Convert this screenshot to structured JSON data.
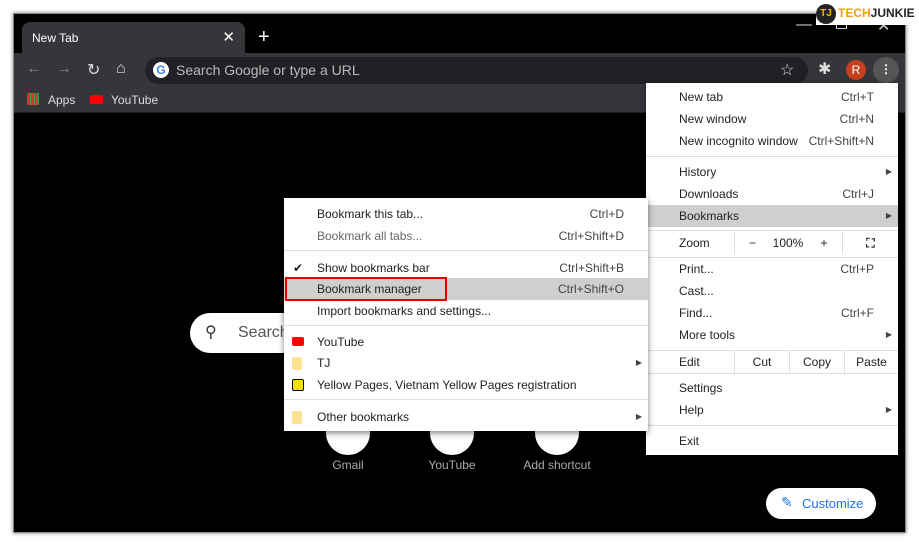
{
  "tab": {
    "title": "New Tab",
    "close": "✕",
    "new": "+"
  },
  "toolbar": {
    "omnibox_placeholder": "Search Google or type a URL",
    "avatar": "R"
  },
  "bookmarks_bar": [
    {
      "label": "Apps",
      "icon": "apps-grid-icon"
    },
    {
      "label": "YouTube",
      "icon": "youtube-icon"
    }
  ],
  "watermark": {
    "text_a": "TECH",
    "text_b": "JUNKIE",
    "mark": "TJ"
  },
  "chrome_menu": {
    "new_tab": {
      "label": "New tab",
      "shortcut": "Ctrl+T"
    },
    "new_window": {
      "label": "New window",
      "shortcut": "Ctrl+N"
    },
    "incognito": {
      "label": "New incognito window",
      "shortcut": "Ctrl+Shift+N"
    },
    "history": {
      "label": "History"
    },
    "downloads": {
      "label": "Downloads",
      "shortcut": "Ctrl+J"
    },
    "bookmarks": {
      "label": "Bookmarks"
    },
    "zoom": {
      "label": "Zoom",
      "minus": "−",
      "value": "100%",
      "plus": "+"
    },
    "print": {
      "label": "Print...",
      "shortcut": "Ctrl+P"
    },
    "cast": {
      "label": "Cast..."
    },
    "find": {
      "label": "Find...",
      "shortcut": "Ctrl+F"
    },
    "more_tools": {
      "label": "More tools"
    },
    "edit": {
      "label": "Edit",
      "cut": "Cut",
      "copy": "Copy",
      "paste": "Paste"
    },
    "settings": {
      "label": "Settings"
    },
    "help": {
      "label": "Help"
    },
    "exit": {
      "label": "Exit"
    }
  },
  "bookmarks_menu": {
    "bookmark_tab": {
      "label": "Bookmark this tab...",
      "shortcut": "Ctrl+D"
    },
    "bookmark_all": {
      "label": "Bookmark all tabs...",
      "shortcut": "Ctrl+Shift+D"
    },
    "show_bar": {
      "label": "Show bookmarks bar",
      "shortcut": "Ctrl+Shift+B",
      "checked": true
    },
    "manager": {
      "label": "Bookmark manager",
      "shortcut": "Ctrl+Shift+O"
    },
    "import": {
      "label": "Import bookmarks and settings..."
    },
    "youtube": {
      "label": "YouTube"
    },
    "tj": {
      "label": "TJ"
    },
    "yellow": {
      "label": "Yellow Pages, Vietnam Yellow Pages registration"
    },
    "other": {
      "label": "Other bookmarks"
    }
  },
  "ntp": {
    "search_placeholder": "Search",
    "shortcuts": [
      "Gmail",
      "YouTube",
      "Add shortcut"
    ],
    "customize": "Customize"
  },
  "colors": {
    "highlight_box": "#e00000",
    "customize_text": "#1a73e8",
    "avatar": "#c5401c"
  }
}
